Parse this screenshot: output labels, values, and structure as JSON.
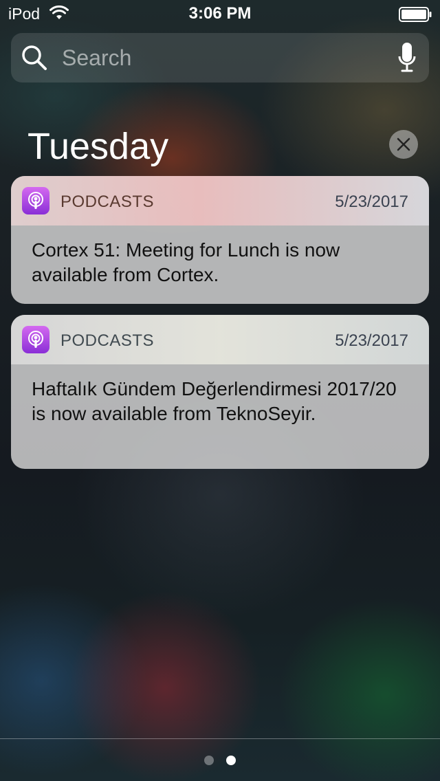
{
  "status_bar": {
    "carrier": "iPod",
    "time": "3:06 PM",
    "wifi_icon": "wifi-icon",
    "battery_icon": "battery-icon"
  },
  "search": {
    "placeholder": "Search",
    "search_icon": "search-icon",
    "mic_icon": "microphone-icon"
  },
  "day_header": {
    "title": "Tuesday",
    "clear_icon": "close-icon"
  },
  "notifications": [
    {
      "app": "PODCASTS",
      "date": "5/23/2017",
      "message": "Cortex 51: Meeting for Lunch is now available from Cortex.",
      "icon": "podcasts-icon"
    },
    {
      "app": "PODCASTS",
      "date": "5/23/2017",
      "message": "Haftalık Gündem Değerlendirmesi 2017/20 is now available from TeknoSeyir.",
      "icon": "podcasts-icon"
    }
  ],
  "page_indicator": {
    "count": 2,
    "current": 2
  },
  "colors": {
    "podcasts_icon_top": "#d46af0",
    "podcasts_icon_bottom": "#8a2ed6"
  }
}
